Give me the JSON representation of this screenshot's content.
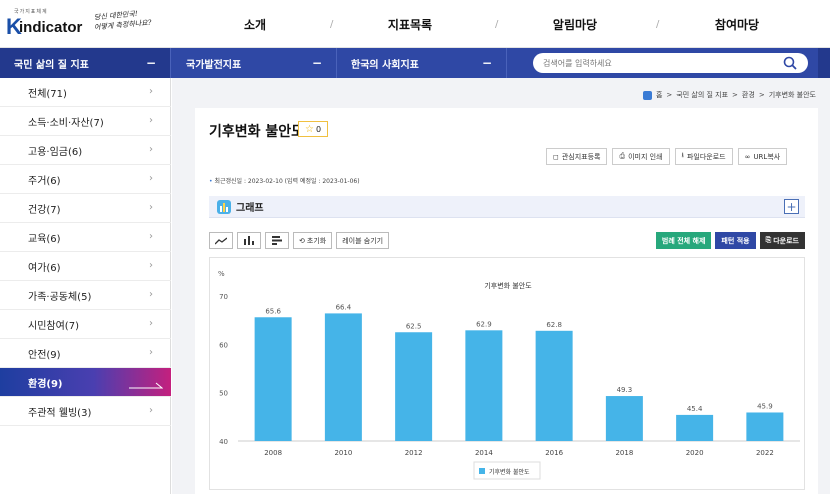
{
  "header": {
    "logo_small": "국가지표체계",
    "logo_word": "indicator",
    "logo_k": "K",
    "slogan_line1": "당신 대한민국!",
    "slogan_line2": "어떻게 측정하나요?",
    "nav": [
      "소개",
      "지표목록",
      "알림마당",
      "참여마당"
    ]
  },
  "navbar": {
    "seg1": "국민 삶의 질 지표",
    "seg2": "국가발전지표",
    "seg3": "한국의 사회지표",
    "minus": "−",
    "search_placeholder": "검색어를 입력하세요"
  },
  "sidebar": {
    "items": [
      {
        "label": "전체(71)"
      },
      {
        "label": "소득·소비·자산(7)"
      },
      {
        "label": "고용·임금(6)"
      },
      {
        "label": "주거(6)"
      },
      {
        "label": "건강(7)"
      },
      {
        "label": "교육(6)"
      },
      {
        "label": "여가(6)"
      },
      {
        "label": "가족·공동체(5)"
      },
      {
        "label": "시민참여(7)"
      },
      {
        "label": "안전(9)"
      },
      {
        "label": "환경(9)"
      },
      {
        "label": "주관적 웰빙(3)"
      }
    ],
    "active_index": 10
  },
  "breadcrumb": {
    "home": "홈",
    "items": [
      "국민 삶의 질 지표",
      "환경",
      "기후변화 불안도"
    ]
  },
  "page": {
    "title": "기후변화 불안도",
    "star_count": "0",
    "actions": [
      "관심지표등록",
      "이미지 인쇄",
      "파일다운로드",
      "URL복사"
    ],
    "updated": "최근갱신일 : 2023-02-10 (입력 예정일 : 2023-01-06)",
    "graph_label": "그래프",
    "plus": "+",
    "tools": [
      "초기화",
      "레이블 숨기기"
    ],
    "right_tools": [
      "범례 전체 해제",
      "패턴 적용",
      "다운로드"
    ],
    "colors": {
      "green": "#27a87c",
      "blue": "#2f48a5",
      "dark": "#333333",
      "bar": "#45b4e8"
    }
  },
  "chart_data": {
    "type": "bar",
    "title": "기후변화 불안도",
    "ylabel": "%",
    "categories": [
      "2008",
      "2010",
      "2012",
      "2014",
      "2016",
      "2018",
      "2020",
      "2022"
    ],
    "series": [
      {
        "name": "기후변화 불안도",
        "values": [
          65.6,
          66.4,
          62.5,
          62.9,
          62.8,
          49.3,
          45.4,
          45.9
        ]
      }
    ],
    "ylim": [
      40,
      70
    ],
    "yticks": [
      40,
      50,
      60,
      70
    ],
    "grid": false,
    "legend": "bottom-center"
  }
}
